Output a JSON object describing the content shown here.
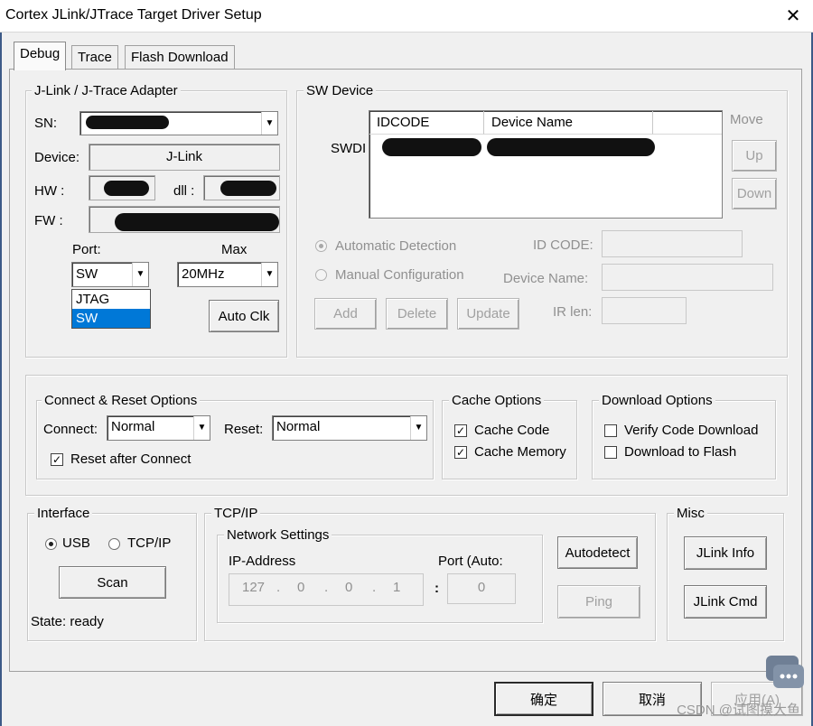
{
  "window": {
    "title": "Cortex JLink/JTrace Target Driver Setup",
    "close_glyph": "✕"
  },
  "tabs": [
    {
      "label": "Debug"
    },
    {
      "label": "Trace"
    },
    {
      "label": "Flash Download"
    }
  ],
  "adapter": {
    "group_label": "J-Link / J-Trace Adapter",
    "sn_label": "SN:",
    "device_label": "Device:",
    "device_value": "J-Link",
    "hw_label": "HW :",
    "dll_label": "dll :",
    "fw_label": "FW :",
    "port_label": "Port:",
    "port_value": "SW",
    "port_options": [
      "JTAG",
      "SW"
    ],
    "max_label": "Max",
    "max_value": "20MHz",
    "auto_clk_label": "Auto Clk"
  },
  "sw_device": {
    "group_label": "SW Device",
    "swdi_label": "SWDI",
    "col_idcode": "IDCODE",
    "col_device_name": "Device Name",
    "move_label": "Move",
    "up_label": "Up",
    "down_label": "Down",
    "auto_detection_label": "Automatic Detection",
    "manual_config_label": "Manual Configuration",
    "id_code_label": "ID CODE:",
    "device_name_label": "Device Name:",
    "ir_len_label": "IR len:",
    "add_label": "Add",
    "delete_label": "Delete",
    "update_label": "Update"
  },
  "connect_reset": {
    "group_label": "Connect & Reset Options",
    "connect_label": "Connect:",
    "connect_value": "Normal",
    "reset_label": "Reset:",
    "reset_value": "Normal",
    "reset_after_connect_label": "Reset after Connect"
  },
  "cache": {
    "group_label": "Cache Options",
    "cache_code_label": "Cache Code",
    "cache_memory_label": "Cache Memory"
  },
  "download": {
    "group_label": "Download Options",
    "verify_label": "Verify Code Download",
    "download_flash_label": "Download to Flash"
  },
  "interface": {
    "group_label": "Interface",
    "usb_label": "USB",
    "tcpip_label": "TCP/IP",
    "scan_label": "Scan",
    "state_text": "State: ready"
  },
  "tcpip": {
    "group_label": "TCP/IP",
    "network_label": "Network Settings",
    "ip_label": "IP-Address",
    "ip_octets": [
      "127",
      "0",
      "0",
      "1"
    ],
    "port_label": "Port (Auto:",
    "port_colon": ":",
    "port_value": "0",
    "autodetect_label": "Autodetect",
    "ping_label": "Ping"
  },
  "misc": {
    "group_label": "Misc",
    "jlink_info_label": "JLink Info",
    "jlink_cmd_label": "JLink Cmd"
  },
  "footer": {
    "ok_label": "确定",
    "cancel_label": "取消",
    "apply_label": "应用(A)"
  },
  "watermark": "CSDN @试图摸大鱼",
  "colors": {
    "title_bar": "#ffffff",
    "dialog_bg": "#f0f0f0",
    "selection": "#0078d7",
    "window_border": "#3d5a87"
  }
}
